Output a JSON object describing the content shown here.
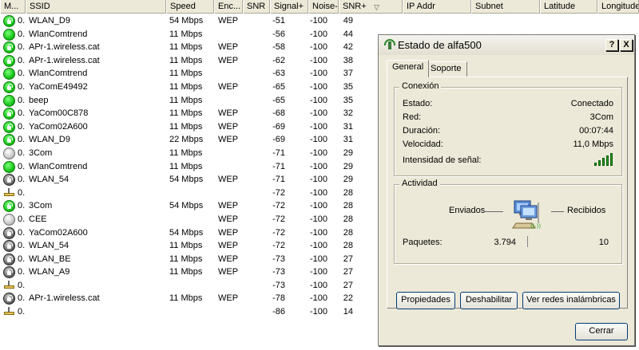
{
  "list": {
    "columns": [
      "M...",
      "SSID",
      "Speed",
      "Enc...",
      "SNR",
      "Signal+",
      "Noise-",
      "SNR+",
      "IP Addr",
      "Subnet",
      "Latitude",
      "Longitude"
    ],
    "rows": [
      {
        "icon": "green-lock",
        "mac": "0.",
        "ssid": "WLAN_D9",
        "speed": "54 Mbps",
        "enc": "WEP",
        "signal": "-51",
        "noise": "-100",
        "snr": "49"
      },
      {
        "icon": "green",
        "mac": "0.",
        "ssid": "WlanComtrend",
        "speed": "11 Mbps",
        "enc": "",
        "signal": "-56",
        "noise": "-100",
        "snr": "44"
      },
      {
        "icon": "green-lock",
        "mac": "0.",
        "ssid": "APr-1.wireless.cat",
        "speed": "11 Mbps",
        "enc": "WEP",
        "signal": "-58",
        "noise": "-100",
        "snr": "42"
      },
      {
        "icon": "green-lock",
        "mac": "0.",
        "ssid": "APr-1.wireless.cat",
        "speed": "11 Mbps",
        "enc": "WEP",
        "signal": "-62",
        "noise": "-100",
        "snr": "38"
      },
      {
        "icon": "green",
        "mac": "0.",
        "ssid": "WlanComtrend",
        "speed": "11 Mbps",
        "enc": "",
        "signal": "-63",
        "noise": "-100",
        "snr": "37"
      },
      {
        "icon": "green-lock",
        "mac": "0.",
        "ssid": "YaComE49492",
        "speed": "11 Mbps",
        "enc": "WEP",
        "signal": "-65",
        "noise": "-100",
        "snr": "35"
      },
      {
        "icon": "green",
        "mac": "0.",
        "ssid": "beep",
        "speed": "11 Mbps",
        "enc": "",
        "signal": "-65",
        "noise": "-100",
        "snr": "35"
      },
      {
        "icon": "green-lock",
        "mac": "0.",
        "ssid": "YaCom00C878",
        "speed": "11 Mbps",
        "enc": "WEP",
        "signal": "-68",
        "noise": "-100",
        "snr": "32"
      },
      {
        "icon": "green-lock",
        "mac": "0.",
        "ssid": "YaCom02A600",
        "speed": "11 Mbps",
        "enc": "WEP",
        "signal": "-69",
        "noise": "-100",
        "snr": "31"
      },
      {
        "icon": "green-lock",
        "mac": "0.",
        "ssid": "WLAN_D9",
        "speed": "22 Mbps",
        "enc": "WEP",
        "signal": "-69",
        "noise": "-100",
        "snr": "31"
      },
      {
        "icon": "gray",
        "mac": "0.",
        "ssid": "3Com",
        "speed": "11 Mbps",
        "enc": "",
        "signal": "-71",
        "noise": "-100",
        "snr": "29"
      },
      {
        "icon": "green",
        "mac": "0.",
        "ssid": "WlanComtrend",
        "speed": "11 Mbps",
        "enc": "",
        "signal": "-71",
        "noise": "-100",
        "snr": "29"
      },
      {
        "icon": "dark-lock",
        "mac": "0.",
        "ssid": "WLAN_54",
        "speed": "54 Mbps",
        "enc": "WEP",
        "signal": "-71",
        "noise": "-100",
        "snr": "29"
      },
      {
        "icon": "adhoc",
        "mac": "0.",
        "ssid": "",
        "speed": "",
        "enc": "",
        "signal": "-72",
        "noise": "-100",
        "snr": "28"
      },
      {
        "icon": "green-lock",
        "mac": "0.",
        "ssid": "3Com",
        "speed": "54 Mbps",
        "enc": "WEP",
        "signal": "-72",
        "noise": "-100",
        "snr": "28"
      },
      {
        "icon": "gray",
        "mac": "0.",
        "ssid": "CEE",
        "speed": "",
        "enc": "WEP",
        "signal": "-72",
        "noise": "-100",
        "snr": "28"
      },
      {
        "icon": "dark-lock",
        "mac": "0.",
        "ssid": "YaCom02A600",
        "speed": "54 Mbps",
        "enc": "WEP",
        "signal": "-72",
        "noise": "-100",
        "snr": "28"
      },
      {
        "icon": "dark-lock",
        "mac": "0.",
        "ssid": "WLAN_54",
        "speed": "11 Mbps",
        "enc": "WEP",
        "signal": "-72",
        "noise": "-100",
        "snr": "28"
      },
      {
        "icon": "dark-lock",
        "mac": "0.",
        "ssid": "WLAN_BE",
        "speed": "11 Mbps",
        "enc": "WEP",
        "signal": "-73",
        "noise": "-100",
        "snr": "27"
      },
      {
        "icon": "dark-lock",
        "mac": "0.",
        "ssid": "WLAN_A9",
        "speed": "11 Mbps",
        "enc": "WEP",
        "signal": "-73",
        "noise": "-100",
        "snr": "27"
      },
      {
        "icon": "adhoc",
        "mac": "0.",
        "ssid": "",
        "speed": "",
        "enc": "",
        "signal": "-73",
        "noise": "-100",
        "snr": "27"
      },
      {
        "icon": "dark-lock",
        "mac": "0.",
        "ssid": "APr-1.wireless.cat",
        "speed": "11 Mbps",
        "enc": "WEP",
        "signal": "-78",
        "noise": "-100",
        "snr": "22"
      },
      {
        "icon": "adhoc",
        "mac": "0.",
        "ssid": "",
        "speed": "",
        "enc": "",
        "signal": "-86",
        "noise": "-100",
        "snr": "14"
      }
    ]
  },
  "dialog": {
    "title": "Estado de alfa500",
    "help_label": "?",
    "close_label": "X",
    "tabs": [
      "General",
      "Soporte"
    ],
    "connection": {
      "legend": "Conexión",
      "status_label": "Estado:",
      "status_value": "Conectado",
      "network_label": "Red:",
      "network_value": "3Com",
      "duration_label": "Duración:",
      "duration_value": "00:07:44",
      "speed_label": "Velocidad:",
      "speed_value": "11,0 Mbps",
      "signal_label": "Intensidad de señal:",
      "signal_bars": 5
    },
    "activity": {
      "legend": "Actividad",
      "sent_label": "Enviados",
      "received_label": "Recibidos",
      "packets_label": "Paquetes:",
      "packets_sent": "3.794",
      "packets_received": "10"
    },
    "buttons": {
      "properties": "Propiedades",
      "disable": "Deshabilitar",
      "view_networks": "Ver redes inalámbricas",
      "close": "Cerrar"
    }
  },
  "colors": {
    "connected_green": "#19c619",
    "titlebar_bg": "#e3e0d1",
    "dialog_bg": "#ece9d8"
  }
}
